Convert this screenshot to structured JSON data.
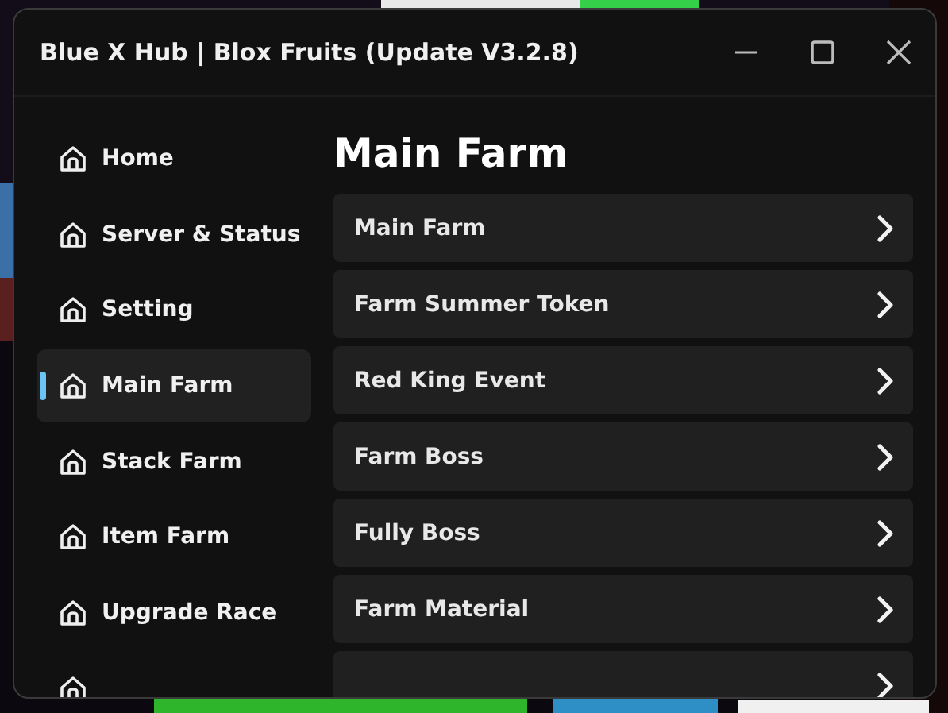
{
  "window": {
    "title": "Blue X Hub | Blox Fruits (Update V3.2.8)"
  },
  "sidebar": {
    "items": [
      {
        "label": "Home",
        "selected": false
      },
      {
        "label": "Server & Status",
        "selected": false
      },
      {
        "label": "Setting",
        "selected": false
      },
      {
        "label": "Main Farm",
        "selected": true
      },
      {
        "label": "Stack Farm",
        "selected": false
      },
      {
        "label": "Item Farm",
        "selected": false
      },
      {
        "label": "Upgrade Race",
        "selected": false
      },
      {
        "selected": false
      }
    ]
  },
  "content": {
    "title": "Main Farm",
    "rows": [
      {
        "label": "Main Farm"
      },
      {
        "label": "Farm Summer Token"
      },
      {
        "label": "Red King Event"
      },
      {
        "label": "Farm Boss"
      },
      {
        "label": "Fully Boss"
      },
      {
        "label": "Farm Material"
      },
      {}
    ]
  }
}
